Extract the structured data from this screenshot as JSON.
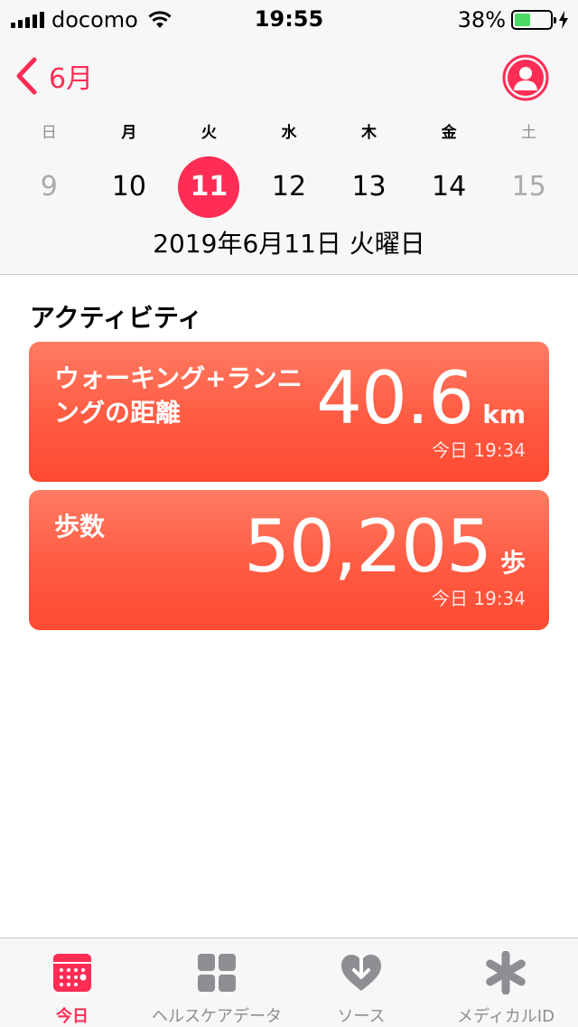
{
  "status_bar": {
    "carrier": "docomo",
    "time": "19:55",
    "battery": "38%"
  },
  "header": {
    "back_label": "6月",
    "weekdays": [
      "日",
      "月",
      "火",
      "水",
      "木",
      "金",
      "土"
    ],
    "days": [
      "9",
      "10",
      "11",
      "12",
      "13",
      "14",
      "15"
    ],
    "selected_date": "2019年6月11日 火曜日"
  },
  "activity": {
    "title": "アクティビティ",
    "cards": [
      {
        "label": "ウォーキング+ランニングの距離",
        "value": "40.6",
        "unit": "km",
        "time": "今日 19:34"
      },
      {
        "label": "歩数",
        "value": "50,205",
        "unit": "歩",
        "time": "今日 19:34"
      }
    ]
  },
  "tabs": [
    {
      "label": "今日",
      "icon": "calendar-icon",
      "active": true
    },
    {
      "label": "ヘルスケアデータ",
      "icon": "grid-icon",
      "active": false
    },
    {
      "label": "ソース",
      "icon": "heart-download-icon",
      "active": false
    },
    {
      "label": "メディカルID",
      "icon": "asterisk-icon",
      "active": false
    }
  ],
  "colors": {
    "accent": "#ff2d55",
    "card": "#ff5a42",
    "battery": "#4cd964"
  }
}
